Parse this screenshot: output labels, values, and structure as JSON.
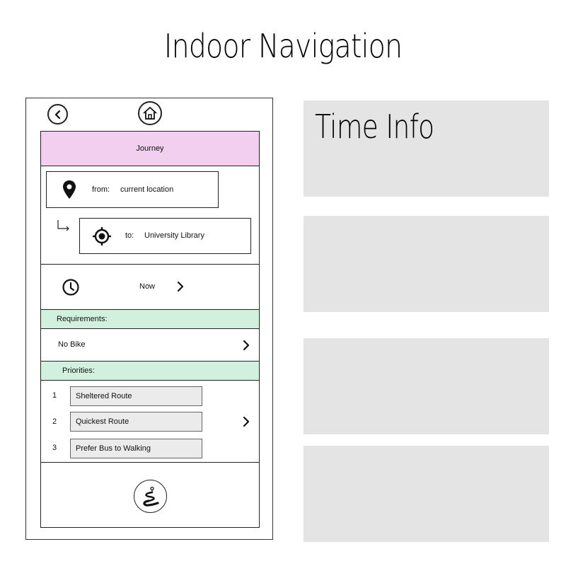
{
  "page_title": "Indoor Navigation",
  "journey_label": "Journey",
  "from": {
    "prefix": "from:",
    "value": "current location"
  },
  "to": {
    "prefix": "to:",
    "value": "University Library"
  },
  "time": {
    "label": "Now"
  },
  "requirements": {
    "header": "Requirements:",
    "value": "No Bike"
  },
  "priorities": {
    "header": "Priorities:",
    "items": [
      {
        "num": "1",
        "label": "Sheltered Route"
      },
      {
        "num": "2",
        "label": "Quickest Route"
      },
      {
        "num": "3",
        "label": "Prefer Bus to Walking"
      }
    ]
  },
  "panels": {
    "time_info_title": "Time Info"
  },
  "colors": {
    "journey_bg": "#f2cfee",
    "section_bg": "#d1f1de",
    "panel_bg": "#e4e4e4"
  }
}
